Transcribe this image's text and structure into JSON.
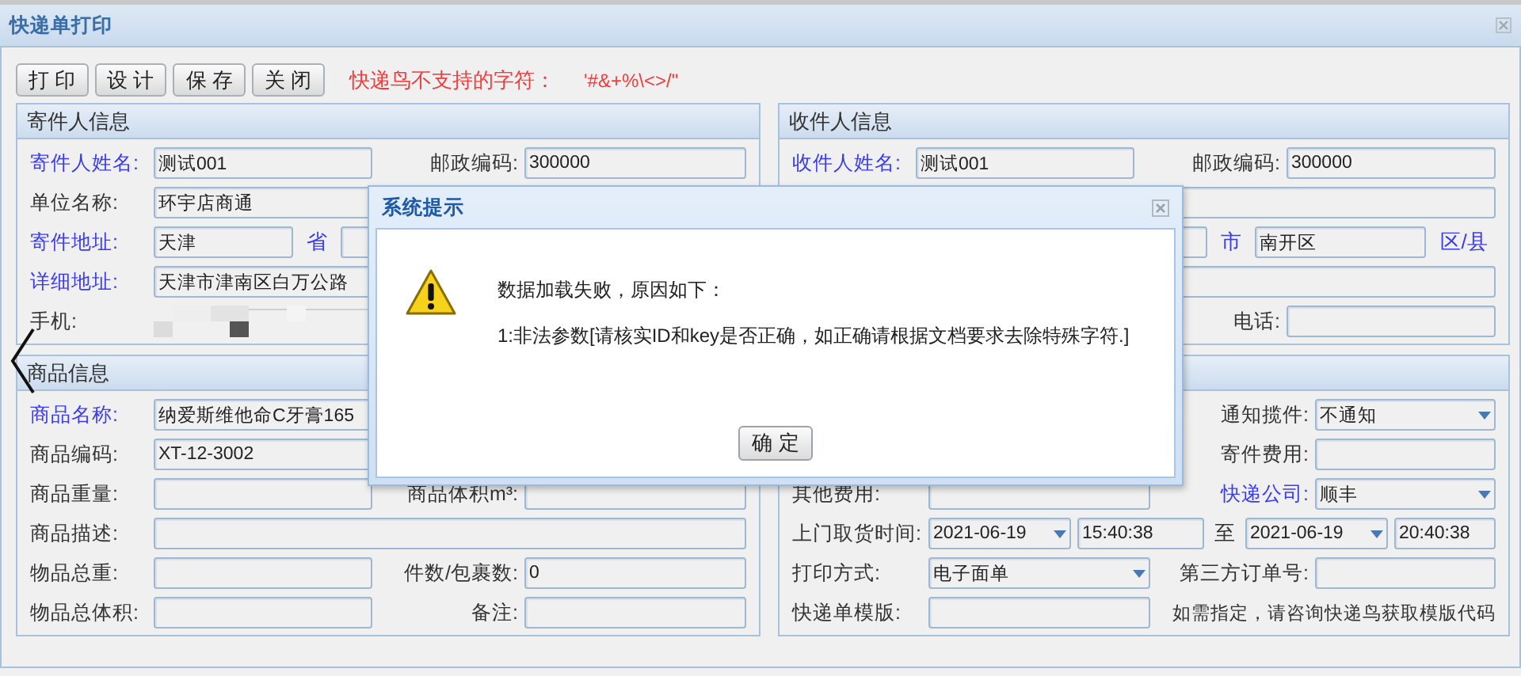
{
  "window": {
    "title": "快递单打印"
  },
  "toolbar": {
    "buttons": [
      "打 印",
      "设 计",
      "保 存",
      "关 闭"
    ],
    "note": "快递鸟不支持的字符：",
    "chars": "'#&+%\\<>/\""
  },
  "panels": [
    {
      "title": "寄件人信息",
      "rows": [
        {
          "kind": "pair",
          "parts": [
            {
              "kind": "label",
              "text": "寄件人姓名:",
              "required": true
            },
            {
              "kind": "field",
              "value": "测试001"
            },
            {
              "kind": "label",
              "text": "邮政编码:",
              "required": false
            },
            {
              "kind": "field",
              "value": "300000"
            }
          ]
        },
        {
          "kind": "wide",
          "parts": [
            {
              "kind": "label",
              "text": "单位名称:",
              "required": false
            },
            {
              "kind": "field",
              "value": "环宇店商通"
            }
          ]
        },
        {
          "kind": "address",
          "parts": [
            {
              "kind": "label",
              "text": "寄件地址:",
              "required": true
            },
            {
              "kind": "field",
              "value": "天津"
            },
            {
              "kind": "unit",
              "text": "省",
              "emphasis": true
            },
            {
              "kind": "field"
            }
          ]
        },
        {
          "kind": "wide",
          "parts": [
            {
              "kind": "label",
              "text": "详细地址:",
              "required": true
            },
            {
              "kind": "field",
              "value": "天津市津南区白万公路"
            }
          ]
        },
        {
          "kind": "masked",
          "parts": [
            {
              "kind": "label",
              "text": "手机:",
              "required": false
            },
            {
              "kind": "masked"
            }
          ]
        }
      ]
    },
    {
      "title": "收件人信息",
      "rows": [
        {
          "kind": "pair",
          "parts": [
            {
              "kind": "label",
              "text": "收件人姓名:",
              "required": true
            },
            {
              "kind": "field",
              "value": "测试001"
            },
            {
              "kind": "label",
              "text": "邮政编码:",
              "required": false
            },
            {
              "kind": "field",
              "value": "300000"
            }
          ]
        },
        {
          "kind": "wide",
          "parts": [
            {
              "kind": "label"
            },
            {
              "kind": "field"
            }
          ]
        },
        {
          "kind": "city",
          "parts": [
            {
              "kind": "label"
            },
            {
              "kind": "field"
            },
            {
              "kind": "unit",
              "text": "市",
              "emphasis": true
            },
            {
              "kind": "field",
              "value": "南开区"
            },
            {
              "kind": "unit",
              "text": "区/县",
              "emphasis": true
            }
          ]
        },
        {
          "kind": "wide",
          "parts": [
            {
              "kind": "label"
            },
            {
              "kind": "field"
            }
          ]
        },
        {
          "kind": "pair",
          "parts": [
            {
              "kind": "label"
            },
            {
              "kind": "covered"
            },
            {
              "kind": "label",
              "text": "电话:",
              "required": false
            },
            {
              "kind": "field"
            }
          ]
        }
      ]
    },
    {
      "title": "商品信息",
      "rows": [
        {
          "kind": "wide",
          "parts": [
            {
              "kind": "label",
              "text": "商品名称:",
              "required": true
            },
            {
              "kind": "field",
              "value": "纳爱斯维他命C牙膏165"
            }
          ]
        },
        {
          "kind": "pair",
          "parts": [
            {
              "kind": "label",
              "text": "商品编码:",
              "required": false
            },
            {
              "kind": "field",
              "value": "XT-12-3002"
            },
            {
              "kind": "label"
            },
            {
              "kind": "covered"
            }
          ]
        },
        {
          "kind": "pair",
          "parts": [
            {
              "kind": "label",
              "text": "商品重量:",
              "required": false
            },
            {
              "kind": "field"
            },
            {
              "kind": "label",
              "text": "商品体积m³:",
              "required": false
            },
            {
              "kind": "field"
            }
          ]
        },
        {
          "kind": "wide",
          "parts": [
            {
              "kind": "label",
              "text": "商品描述:",
              "required": false
            },
            {
              "kind": "field"
            }
          ]
        },
        {
          "kind": "pair",
          "parts": [
            {
              "kind": "label",
              "text": "物品总重:",
              "required": false
            },
            {
              "kind": "field"
            },
            {
              "kind": "label",
              "text": "件数/包裹数:",
              "required": false
            },
            {
              "kind": "field",
              "value": "0"
            }
          ]
        },
        {
          "kind": "pair",
          "parts": [
            {
              "kind": "label",
              "text": "物品总体积:",
              "required": false
            },
            {
              "kind": "field"
            },
            {
              "kind": "label",
              "text": "备注:",
              "required": false
            },
            {
              "kind": "field"
            }
          ]
        }
      ]
    },
    {
      "rows": [
        {
          "kind": "pair",
          "parts": [
            {
              "kind": "label"
            },
            {
              "kind": "covered"
            },
            {
              "kind": "label",
              "text": "通知揽件:",
              "required": false
            },
            {
              "kind": "select",
              "value": "不通知"
            }
          ]
        },
        {
          "kind": "pair",
          "parts": [
            {
              "kind": "label"
            },
            {
              "kind": "covered"
            },
            {
              "kind": "label",
              "text": "寄件费用:",
              "required": false
            },
            {
              "kind": "field"
            }
          ]
        },
        {
          "kind": "pair",
          "parts": [
            {
              "kind": "label",
              "text": "其他费用:",
              "required": false
            },
            {
              "kind": "field"
            },
            {
              "kind": "label",
              "text": "快递公司:",
              "required": true
            },
            {
              "kind": "select",
              "value": "顺丰"
            }
          ]
        },
        {
          "kind": "time",
          "parts": [
            {
              "kind": "label",
              "text": "上门取货时间:",
              "required": false
            },
            {
              "kind": "select",
              "value": "2021-06-19"
            },
            {
              "kind": "field",
              "value": "15:40:38"
            },
            {
              "kind": "unit",
              "text": "至",
              "emphasis": false
            },
            {
              "kind": "select",
              "value": "2021-06-19"
            },
            {
              "kind": "field",
              "value": "20:40:38"
            }
          ]
        },
        {
          "kind": "pair",
          "parts": [
            {
              "kind": "label",
              "text": "打印方式:",
              "required": false
            },
            {
              "kind": "select",
              "value": "电子面单"
            },
            {
              "kind": "label",
              "text": "第三方订单号:",
              "required": false
            },
            {
              "kind": "field"
            }
          ]
        },
        {
          "kind": "pair",
          "parts": [
            {
              "kind": "label",
              "text": "快递单模版:",
              "required": false
            },
            {
              "kind": "field"
            },
            {
              "kind": "note",
              "text": "如需指定，请咨询快递鸟获取模版代码"
            }
          ]
        }
      ]
    }
  ],
  "dialog": {
    "title": "系统提示",
    "message": "数据加载失败，原因如下：",
    "detail": "1:非法参数[请核实ID和key是否正确，如正确请根据文档要求去除特殊字符.]",
    "button": "确 定"
  }
}
